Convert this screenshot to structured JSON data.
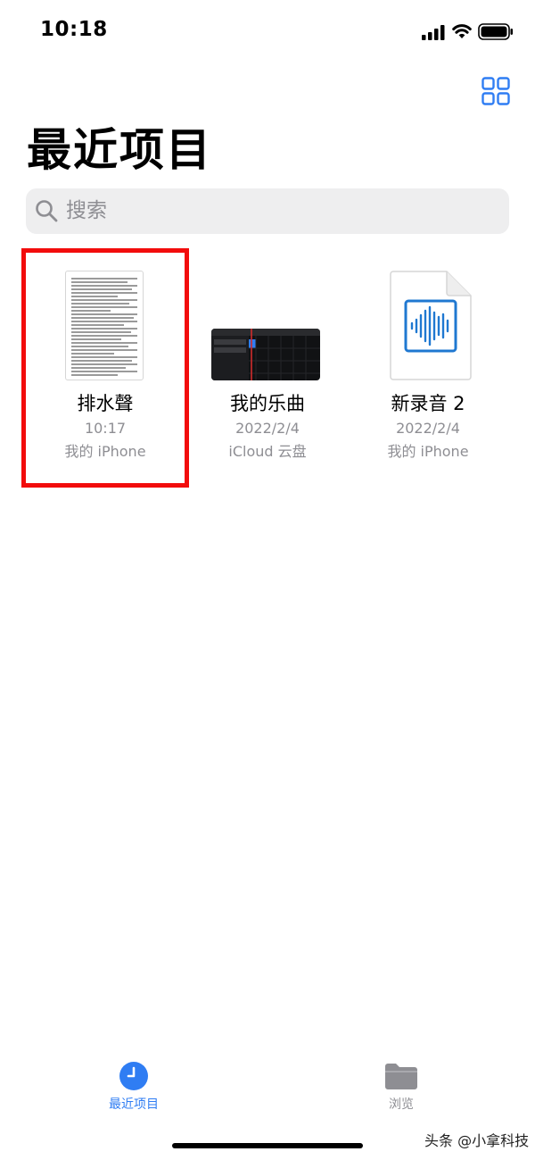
{
  "status_bar": {
    "time": "10:18"
  },
  "header": {
    "title": "最近项目",
    "view_toggle_icon": "grid-icon"
  },
  "search": {
    "placeholder": "搜索"
  },
  "files": [
    {
      "name": "排水聲",
      "date": "10:17",
      "location": "我的 iPhone",
      "thumbnail": "document-icon",
      "highlighted": true
    },
    {
      "name": "我的乐曲",
      "date": "2022/2/4",
      "location": "iCloud 云盘",
      "thumbnail": "music-project-icon",
      "highlighted": false
    },
    {
      "name": "新录音 2",
      "date": "2022/2/4",
      "location": "我的 iPhone",
      "thumbnail": "audio-file-icon",
      "highlighted": false
    }
  ],
  "tab_bar": {
    "recents_label": "最近项目",
    "browse_label": "浏览",
    "recents_icon": "clock-icon",
    "browse_icon": "folder-icon"
  },
  "watermark": "头条 @小拿科技",
  "colors": {
    "accent": "#2f7df3",
    "highlight": "#f20c0c",
    "secondary_text": "#8e8e93",
    "audio_blue": "#1f78d1"
  }
}
